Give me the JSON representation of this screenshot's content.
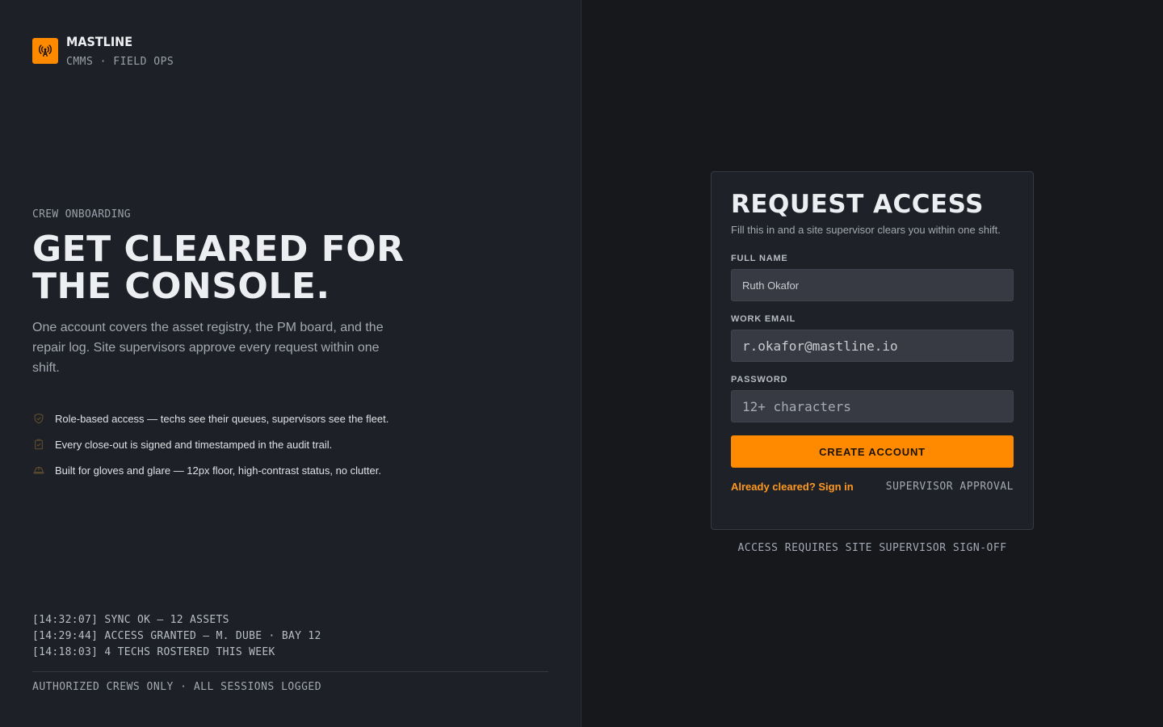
{
  "brand": {
    "name": "MASTLINE",
    "subtitle": "CMMS · FIELD OPS",
    "logo_icon": "antenna-signal-icon",
    "accent": "#ff8a00"
  },
  "intro": {
    "eyebrow": "CREW ONBOARDING",
    "headline": "GET CLEARED FOR THE CONSOLE.",
    "lede": "One account covers the asset registry, the PM board, and the repair log. Site supervisors approve every request within one shift."
  },
  "features": [
    {
      "icon": "shield-check-icon",
      "text": "Role-based access — techs see their queues, supervisors see the fleet."
    },
    {
      "icon": "clipboard-check-icon",
      "text": "Every close-out is signed and timestamped in the audit trail."
    },
    {
      "icon": "hard-hat-icon",
      "text": "Built for gloves and glare — 12px floor, high-contrast status, no clutter."
    }
  ],
  "activity_log": [
    "[14:32:07] SYNC OK — 12 ASSETS",
    "[14:29:44] ACCESS GRANTED — M. DUBE · BAY 12",
    "[14:18:03] 4 TECHS ROSTERED THIS WEEK"
  ],
  "footer_left": "AUTHORIZED CREWS ONLY · ALL SESSIONS LOGGED",
  "form": {
    "title": "REQUEST ACCESS",
    "subtitle": "Fill this in and a site supervisor clears you within one shift.",
    "full_name": {
      "label": "FULL NAME",
      "value": "Ruth Okafor"
    },
    "work_email": {
      "label": "WORK EMAIL",
      "value": "r.okafor@mastline.io"
    },
    "password": {
      "label": "PASSWORD",
      "placeholder": "12+ characters"
    },
    "submit_label": "CREATE ACCOUNT",
    "signin_link": "Already cleared? Sign in",
    "approval_tag": "SUPERVISOR APPROVAL"
  },
  "footer_right": "ACCESS REQUIRES SITE SUPERVISOR SIGN-OFF"
}
